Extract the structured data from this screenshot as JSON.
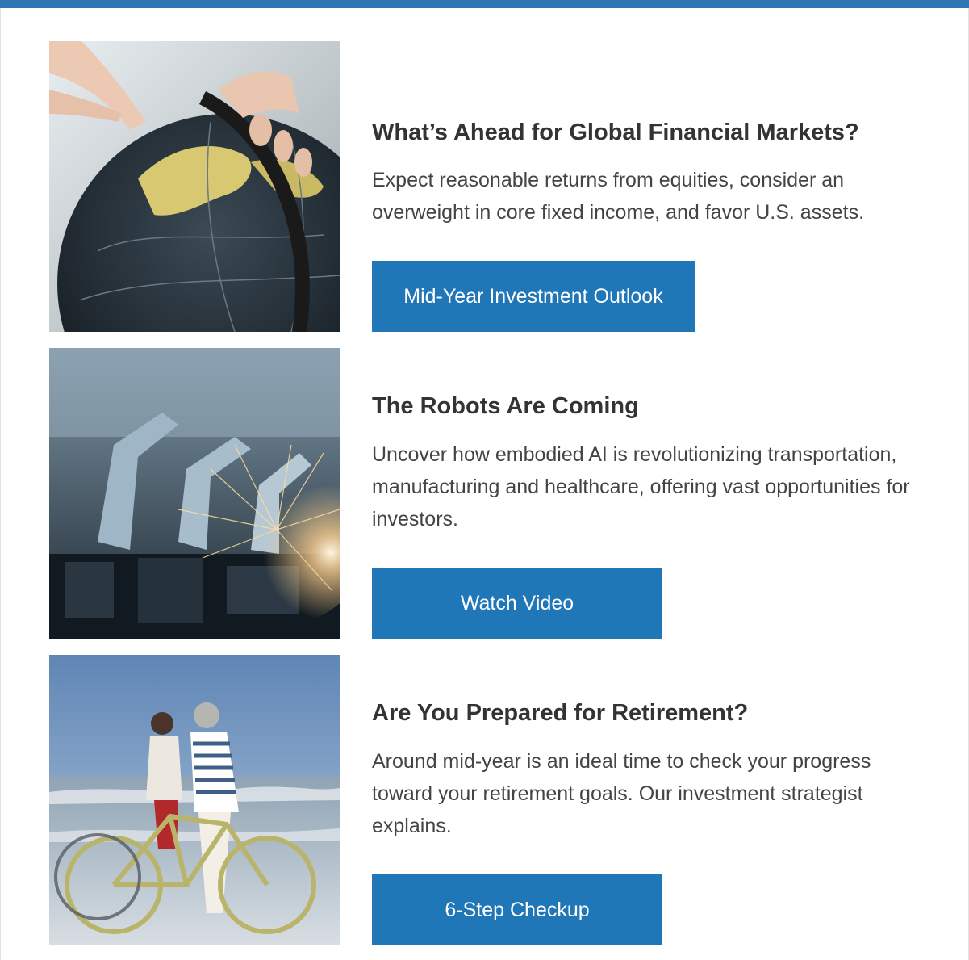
{
  "articles": [
    {
      "title": "What’s Ahead for Global Financial Markets?",
      "description": "Expect reasonable returns from equities, consider an overweight in core fixed income, and favor U.S. assets.",
      "button_label": "Mid-Year Investment Outlook",
      "image_subject": "hands-turning-globe-image"
    },
    {
      "title": "The Robots Are Coming",
      "description": "Uncover how embodied AI is revolutionizing transportation, manufacturing and healthcare, offering vast opportunities for investors.",
      "button_label": "Watch Video",
      "image_subject": "robotic-welding-arms-image"
    },
    {
      "title": "Are You Prepared for Retirement?",
      "description": "Around mid-year is an ideal time to check your progress toward your retirement goals. Our investment strategist explains.",
      "button_label": "6-Step Checkup",
      "image_subject": "couple-walking-bicycles-beach-image"
    }
  ],
  "colors": {
    "accent": "#1f77b8",
    "top_bar": "#2e77b4",
    "heading": "#333333",
    "body_text": "#444444"
  }
}
